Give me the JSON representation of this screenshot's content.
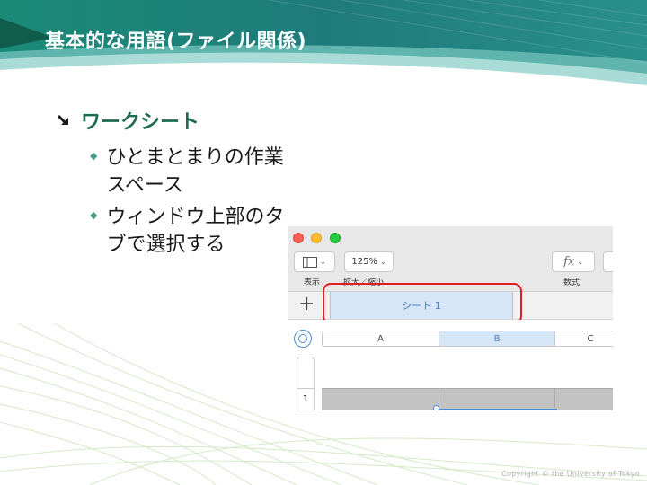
{
  "slide": {
    "title": "基本的な用語(ファイル関係)",
    "bullet_1": "ワークシート",
    "sub_bullets": [
      "ひとまとまりの作業スペース",
      "ウィンドウ上部のタブで選択する"
    ],
    "copyright": "Copyright © the University of Tokyo"
  },
  "screenshot": {
    "toolbar": {
      "zoom_value": "125%",
      "view_label": "表示",
      "zoom_label": "拡大／縮小",
      "formula_label": "数式"
    },
    "sheet_tab_label": "シート 1",
    "columns": [
      "A",
      "B",
      "C"
    ],
    "row_number": "1"
  },
  "colors": {
    "header_teal": "#1f7d7a",
    "bullet_green": "#1f6b52",
    "highlight_red": "#e02020"
  }
}
